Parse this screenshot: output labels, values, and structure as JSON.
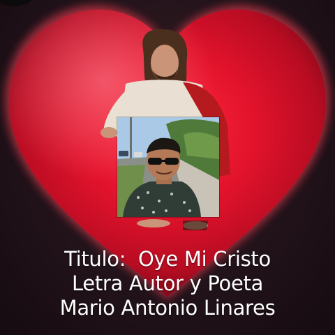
{
  "caption": {
    "line1": "Titulo:  Oye Mi Cristo",
    "line2": "Letra Autor y Poeta",
    "line3": "Mario Antonio Linares"
  },
  "colors": {
    "heart": "#e3132c",
    "heart_glow": "#ff6f7f",
    "background": "#22131a",
    "caption_text": "#ffffff",
    "robe_red": "#b51a1f",
    "robe_white": "#e9dfd2"
  },
  "icons": {
    "heart": "heart-icon",
    "watermark": "corner-mark-icon"
  }
}
